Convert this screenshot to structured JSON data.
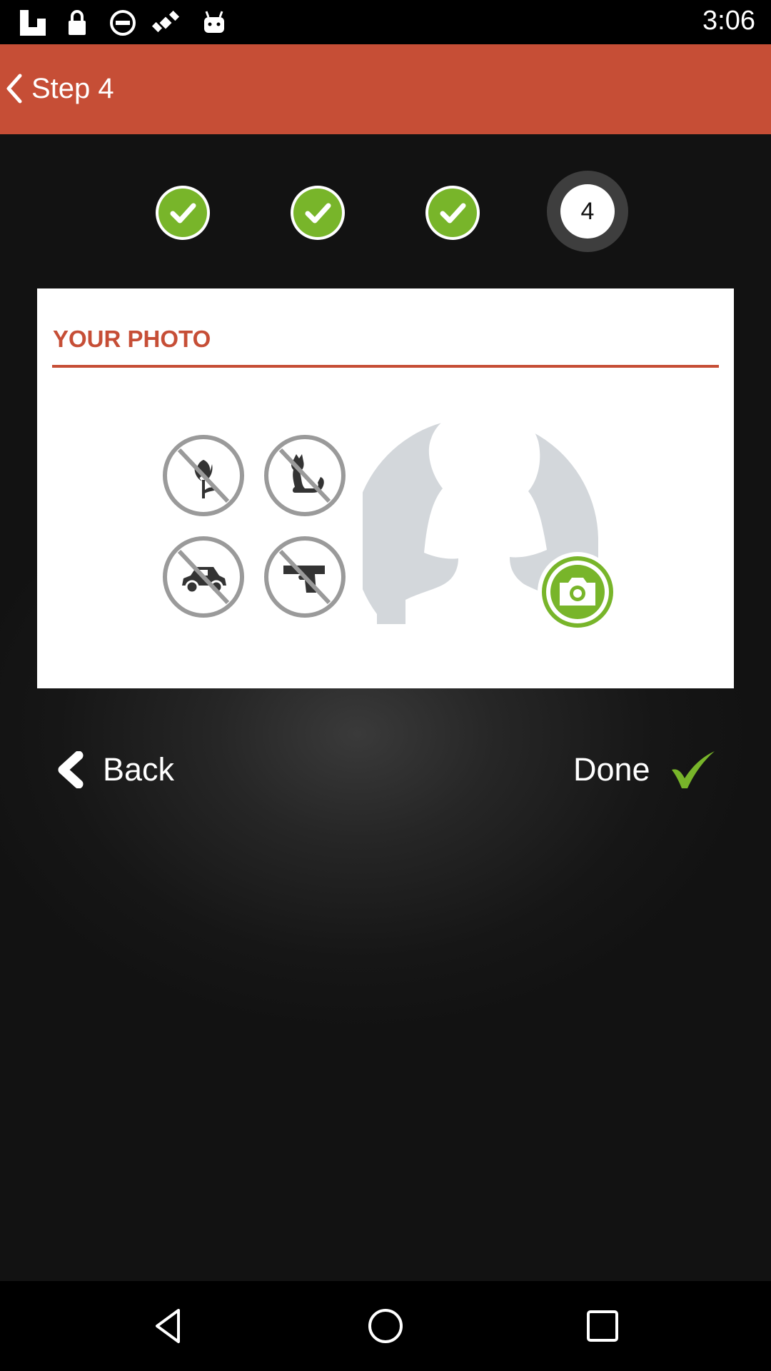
{
  "status_bar": {
    "time": "3:06",
    "icons": [
      "flipboard-icon",
      "lock-icon",
      "do-not-disturb-icon",
      "satellite-icon",
      "android-icon"
    ]
  },
  "app_bar": {
    "title": "Step 4",
    "back_icon": "chevron-left-icon"
  },
  "steps": [
    {
      "state": "done",
      "icon": "check-icon"
    },
    {
      "state": "done",
      "icon": "check-icon"
    },
    {
      "state": "done",
      "icon": "check-icon"
    },
    {
      "state": "current",
      "label": "4"
    }
  ],
  "photo_card": {
    "title": "YOUR PHOTO",
    "banned_icons": [
      "no-flowers-icon",
      "no-pets-icon",
      "no-cars-icon",
      "no-guns-icon"
    ],
    "avatar_icon": "female-silhouette-icon",
    "camera_icon": "camera-icon"
  },
  "nav": {
    "back_label": "Back",
    "done_label": "Done"
  },
  "system_nav": [
    "back-triangle-icon",
    "home-circle-icon",
    "recents-square-icon"
  ],
  "colors": {
    "accent": "#c64e36",
    "success": "#78b52a",
    "background": "#161616"
  }
}
